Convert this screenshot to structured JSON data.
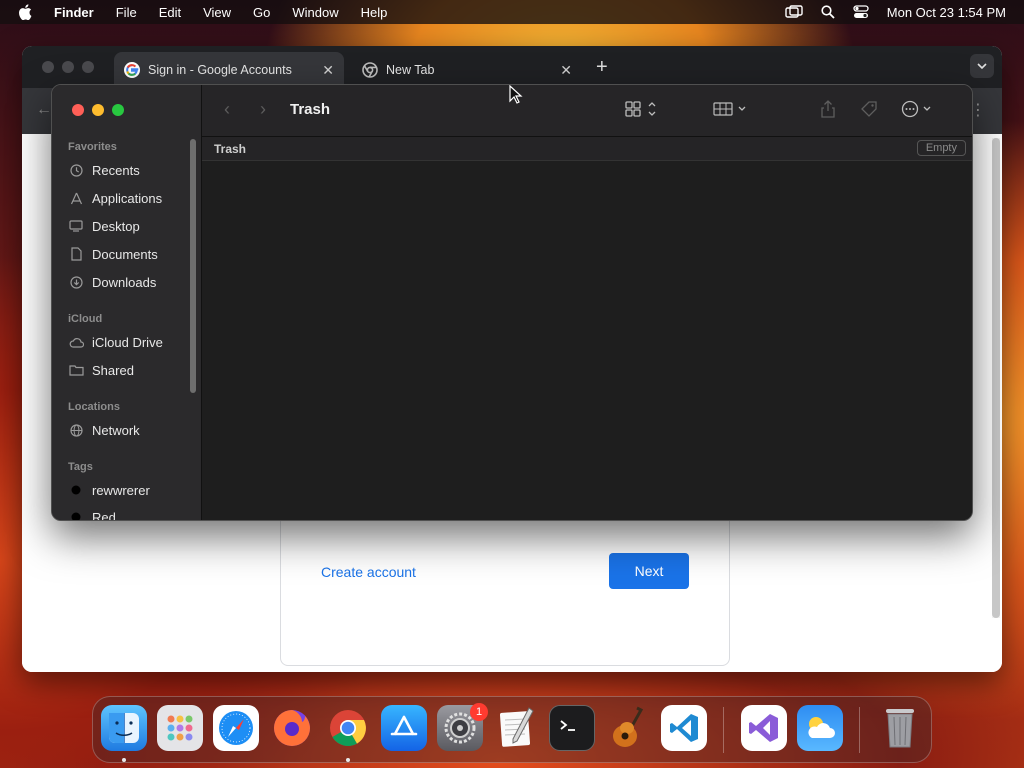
{
  "menubar": {
    "app_name": "Finder",
    "items": [
      "File",
      "Edit",
      "View",
      "Go",
      "Window",
      "Help"
    ],
    "datetime": "Mon Oct 23  1:54 PM"
  },
  "chrome": {
    "tabs": [
      {
        "label": "Sign in - Google Accounts",
        "close": "✕",
        "favicon": "google-icon"
      },
      {
        "label": "New Tab",
        "close": "✕",
        "favicon": "chrome-icon"
      }
    ],
    "new_tab": "+",
    "page": {
      "create_account": "Create account",
      "next": "Next"
    }
  },
  "finder": {
    "title": "Trash",
    "location": "Trash",
    "empty_button": "Empty",
    "sidebar": {
      "favorites_label": "Favorites",
      "favorites": [
        {
          "label": "Recents",
          "icon": "clock-icon"
        },
        {
          "label": "Applications",
          "icon": "applications-icon"
        },
        {
          "label": "Desktop",
          "icon": "desktop-icon"
        },
        {
          "label": "Documents",
          "icon": "document-icon"
        },
        {
          "label": "Downloads",
          "icon": "download-icon"
        }
      ],
      "icloud_label": "iCloud",
      "icloud": [
        {
          "label": "iCloud Drive",
          "icon": "cloud-icon"
        },
        {
          "label": "Shared",
          "icon": "shared-folder-icon"
        }
      ],
      "locations_label": "Locations",
      "locations": [
        {
          "label": "Network",
          "icon": "globe-icon"
        }
      ],
      "tags_label": "Tags",
      "tags": [
        {
          "label": "rewwrerer",
          "color": "#000000"
        },
        {
          "label": "Red",
          "color": "#000000"
        }
      ]
    }
  },
  "dock": {
    "apps": [
      "Finder",
      "Launchpad",
      "Safari",
      "Firefox",
      "Google Chrome",
      "App Store",
      "System Settings",
      "TextEdit",
      "Terminal",
      "GarageBand",
      "Visual Studio Code",
      "Visual Studio",
      "Weather",
      "Trash"
    ],
    "settings_badge": "1"
  },
  "colors": {
    "accent": "#1a73e8",
    "finder_bg": "#1e1e1e",
    "sidebar_bg": "#2b2a2c"
  }
}
